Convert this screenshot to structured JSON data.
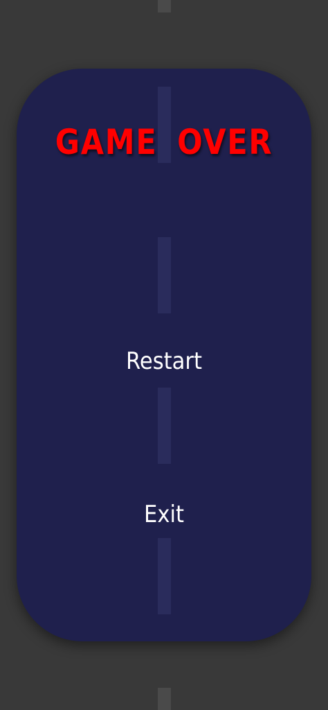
{
  "title": "GAME OVER",
  "menu": {
    "restart_label": "Restart",
    "exit_label": "Exit"
  },
  "colors": {
    "background": "#393939",
    "panel": "#1f204d",
    "title": "#ff0000",
    "menu_text": "#ffffff",
    "road_dash": "#4a4a4a"
  }
}
